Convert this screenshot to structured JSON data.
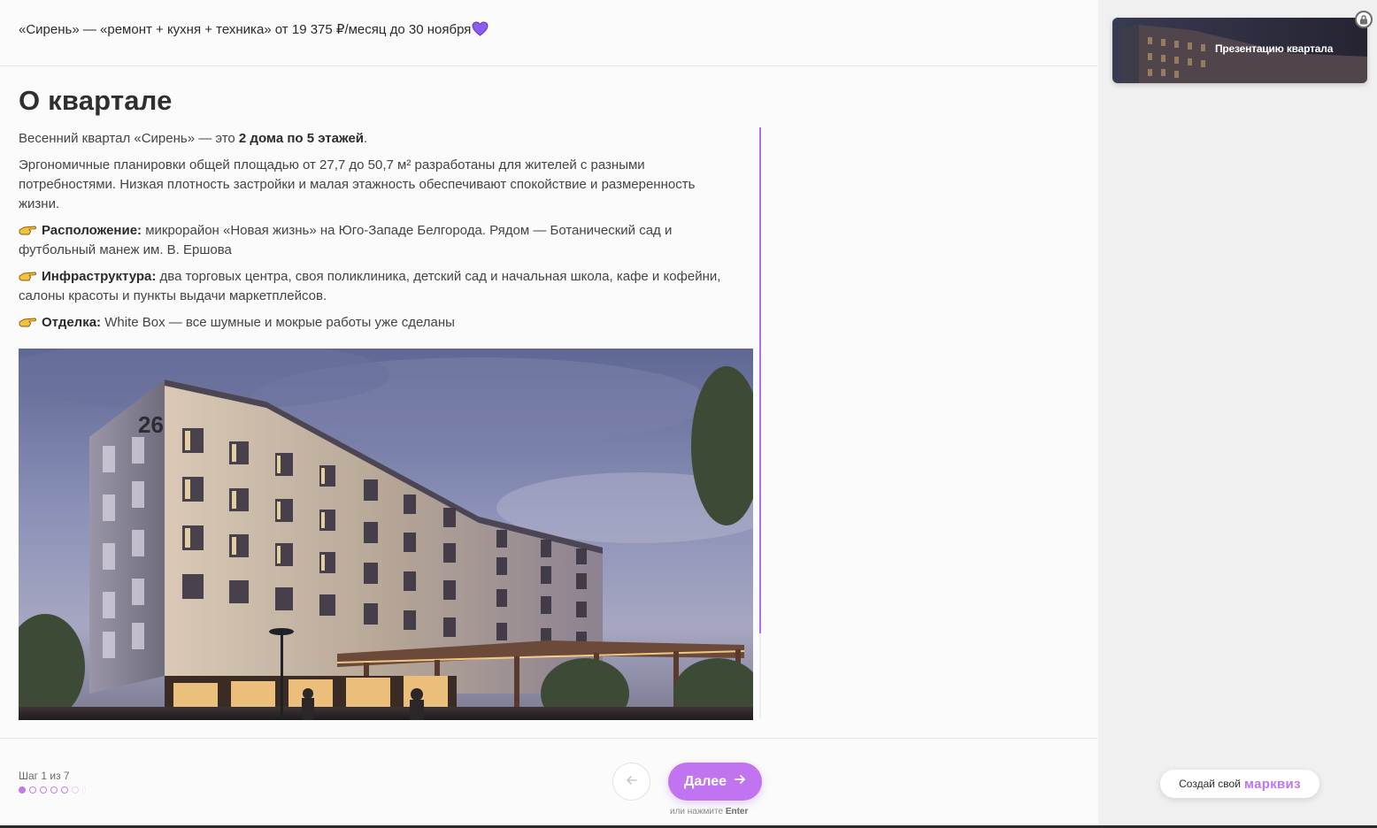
{
  "promo_banner": {
    "text": "«Сирень» — «ремонт + кухня + техника» от 19 375 ₽/месяц до 30 ноября"
  },
  "section": {
    "title": "О квартале",
    "intro_prefix": "Весенний квартал «Сирень» — это ",
    "intro_bold": "2 дома по 5 этажей",
    "intro_suffix": ".",
    "description": "Эргономичные планировки общей площадью от 27,7 до 50,7 м² разработаны для жителей с разными потребностями. Низкая плотность застройки и малая этажность обеспечивают спокойствие и размеренность жизни.",
    "location_label": "Расположение:",
    "location_text": " микрорайон «Новая жизнь» на Юго-Западе Белгорода. Рядом — Ботанический сад и футбольный манеж им. В. Ершова",
    "infra_label": "Инфраструктура:",
    "infra_text": " два торговых центра, своя поликлиника, детский сад и начальная школа, кафе и кофейни, салоны красоты и пункты выдачи маркетплейсов.",
    "finish_label": "Отделка:",
    "finish_text": " White Box — все шумные и мокрые работы уже сделаны",
    "building_number": "26"
  },
  "footer": {
    "step_text": "Шаг 1 из 7",
    "next_label": "Далее",
    "hint_prefix": "или нажмите ",
    "hint_key": "Enter",
    "progress": {
      "current": 1,
      "total": 7
    }
  },
  "sidebar": {
    "preview_label": "Презентацию квартала",
    "brand_prefix": "Создай свой",
    "brand_name": "марквиз"
  },
  "colors": {
    "accent": "#c174f0",
    "heart": "#8a5cf0",
    "pointer": "#f5c33b"
  },
  "icons": [
    "purple-heart-icon",
    "pointing-hand-icon",
    "arrow-left-icon",
    "arrow-right-icon",
    "lock-icon"
  ]
}
